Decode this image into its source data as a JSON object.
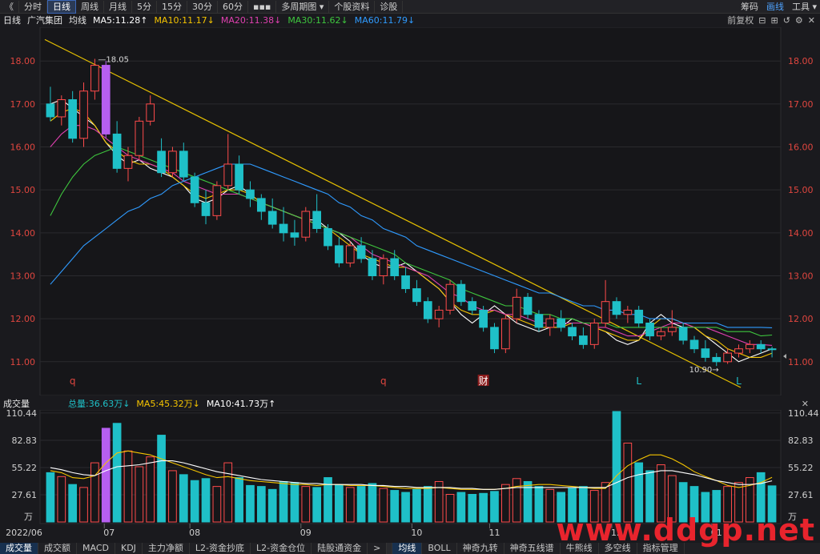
{
  "toolbar": {
    "back": "《",
    "items": [
      "分时",
      "日线",
      "周线",
      "月线",
      "5分",
      "15分",
      "30分",
      "60分",
      "▪▪▪",
      "多周期图 ▾",
      "个股资料",
      "诊股"
    ],
    "active_index": 1,
    "right": [
      "筹码",
      "画线",
      "工具 ▾"
    ]
  },
  "legend": {
    "period": "日线",
    "name": "广汽集团",
    "ma_label": "均线",
    "ma5": "MA5:11.28↑",
    "ma10": "MA10:11.17↓",
    "ma20": "MA20:11.38↓",
    "ma30": "MA30:11.62↓",
    "ma60": "MA60:11.79↓",
    "right_label": "前复权"
  },
  "volume_legend": {
    "title": "成交量",
    "total": "总量:36.63万↓",
    "ma5": "MA5:45.32万↓",
    "ma10": "MA10:41.73万↑"
  },
  "bottom_tabs": [
    "成交量",
    "成交额",
    "MACD",
    "KDJ",
    "主力净额",
    "L2-资金抄底",
    "L2-资金仓位",
    "陆股通资金",
    ">",
    "均线",
    "BOLL",
    "神奇九转",
    "神奇五线谱",
    "牛熊线",
    "多空线",
    "指标管理"
  ],
  "colors": {
    "up": "#ff4b4b",
    "down": "#1fc0c8",
    "ma5": "#ffffff",
    "ma10": "#f5c400",
    "ma20": "#e040b0",
    "ma30": "#3ec63e",
    "ma60": "#2f9bff",
    "trendline": "#e8c200",
    "highlight": "#b65ff0"
  },
  "chart_data": [
    {
      "type": "candlestick",
      "title": "广汽集团 日线",
      "y_ticks": [
        "18.00",
        "17.00",
        "16.00",
        "15.00",
        "14.00",
        "13.00",
        "12.00",
        "11.00"
      ],
      "ylim": [
        10.4,
        18.6
      ],
      "x_ticks": [
        "2022/06",
        "07",
        "08",
        "09",
        "10",
        "11",
        "12",
        "01"
      ],
      "annotations": {
        "high": "18.05",
        "low": "10.90",
        "markers": [
          "q",
          "q",
          "财",
          "L",
          "L"
        ]
      },
      "series": [
        {
          "name": "MA5",
          "values": [
            17.0,
            17.1,
            16.9,
            16.7,
            16.5,
            16.1,
            15.8,
            15.6,
            15.7,
            15.5,
            15.4,
            15.3,
            15.1,
            14.8,
            14.7,
            14.8,
            15.0,
            15.1,
            14.9,
            14.7,
            14.6,
            14.5,
            14.4,
            14.3,
            14.3,
            14.1,
            14.0,
            13.8,
            13.5,
            13.3,
            13.2,
            13.2,
            13.3,
            13.1,
            12.9,
            12.7,
            12.4,
            12.1,
            11.9,
            12.1,
            12.3,
            12.1,
            11.9,
            11.8,
            11.7,
            11.8,
            11.8,
            12.0,
            11.9,
            11.8,
            11.7,
            11.5,
            11.4,
            11.5,
            11.9,
            12.1,
            11.9,
            11.8,
            11.8,
            11.6,
            11.4,
            11.2,
            11.0,
            11.1,
            11.2,
            11.3
          ]
        },
        {
          "name": "MA10",
          "values": [
            16.6,
            16.8,
            16.9,
            16.8,
            16.5,
            16.1,
            15.9,
            15.7,
            15.6,
            15.6,
            15.5,
            15.3,
            15.1,
            14.9,
            14.8,
            14.9,
            15.0,
            15.0,
            14.9,
            14.7,
            14.6,
            14.5,
            14.4,
            14.3,
            14.2,
            14.1,
            13.9,
            13.7,
            13.5,
            13.4,
            13.3,
            13.2,
            13.2,
            13.1,
            12.9,
            12.7,
            12.4,
            12.2,
            12.1,
            12.1,
            12.2,
            12.1,
            12.0,
            11.9,
            11.8,
            11.8,
            11.8,
            11.9,
            11.9,
            11.8,
            11.7,
            11.6,
            11.5,
            11.5,
            11.8,
            12.0,
            12.0,
            11.9,
            11.8,
            11.6,
            11.5,
            11.3,
            11.2,
            11.1,
            11.1,
            11.2
          ]
        },
        {
          "name": "MA20",
          "values": [
            16.0,
            16.3,
            16.5,
            16.5,
            16.4,
            16.2,
            16.0,
            15.8,
            15.7,
            15.6,
            15.5,
            15.4,
            15.2,
            15.1,
            15.0,
            14.9,
            14.9,
            14.9,
            14.8,
            14.7,
            14.6,
            14.5,
            14.4,
            14.3,
            14.2,
            14.1,
            14.0,
            13.9,
            13.7,
            13.5,
            13.4,
            13.3,
            13.2,
            13.1,
            13.0,
            12.8,
            12.6,
            12.5,
            12.3,
            12.2,
            12.2,
            12.1,
            12.1,
            12.0,
            11.9,
            11.9,
            11.9,
            11.9,
            11.9,
            11.8,
            11.8,
            11.7,
            11.6,
            11.6,
            11.7,
            11.8,
            11.9,
            11.9,
            11.8,
            11.8,
            11.7,
            11.6,
            11.5,
            11.4,
            11.4,
            11.38
          ]
        },
        {
          "name": "MA30",
          "values": [
            14.4,
            14.9,
            15.3,
            15.6,
            15.8,
            15.9,
            16.0,
            15.9,
            15.8,
            15.7,
            15.6,
            15.5,
            15.4,
            15.3,
            15.2,
            15.1,
            15.0,
            14.9,
            14.8,
            14.7,
            14.6,
            14.5,
            14.4,
            14.3,
            14.2,
            14.1,
            14.0,
            13.9,
            13.8,
            13.7,
            13.6,
            13.5,
            13.3,
            13.2,
            13.1,
            13.0,
            12.9,
            12.7,
            12.6,
            12.5,
            12.4,
            12.3,
            12.3,
            12.2,
            12.1,
            12.1,
            12.0,
            12.0,
            11.9,
            11.9,
            11.9,
            11.8,
            11.8,
            11.8,
            11.8,
            11.8,
            11.8,
            11.8,
            11.8,
            11.8,
            11.8,
            11.7,
            11.7,
            11.7,
            11.6,
            11.62
          ]
        },
        {
          "name": "MA60",
          "values": [
            12.8,
            13.1,
            13.4,
            13.7,
            13.9,
            14.1,
            14.3,
            14.5,
            14.6,
            14.8,
            14.9,
            15.1,
            15.2,
            15.3,
            15.4,
            15.5,
            15.6,
            15.6,
            15.6,
            15.5,
            15.4,
            15.3,
            15.2,
            15.1,
            15.0,
            14.9,
            14.7,
            14.6,
            14.4,
            14.3,
            14.1,
            14.0,
            13.9,
            13.7,
            13.6,
            13.5,
            13.4,
            13.3,
            13.2,
            13.1,
            13.0,
            12.9,
            12.8,
            12.7,
            12.6,
            12.6,
            12.5,
            12.4,
            12.3,
            12.3,
            12.2,
            12.2,
            12.1,
            12.1,
            12.0,
            12.0,
            12.0,
            11.9,
            11.9,
            11.9,
            11.9,
            11.8,
            11.8,
            11.8,
            11.8,
            11.79
          ]
        }
      ],
      "candles": [
        [
          17.0,
          17.4,
          16.6,
          16.7
        ],
        [
          16.7,
          17.2,
          16.5,
          17.1
        ],
        [
          17.1,
          17.3,
          16.1,
          16.2
        ],
        [
          16.2,
          17.5,
          16.0,
          17.3
        ],
        [
          17.3,
          18.05,
          17.1,
          17.9
        ],
        [
          17.9,
          18.0,
          16.2,
          16.3
        ],
        [
          16.3,
          16.6,
          15.4,
          15.5
        ],
        [
          15.5,
          16.0,
          15.2,
          15.8
        ],
        [
          15.8,
          16.7,
          15.7,
          16.6
        ],
        [
          16.6,
          17.2,
          16.5,
          17.0
        ],
        [
          15.9,
          16.2,
          15.3,
          15.4
        ],
        [
          15.4,
          16.0,
          15.3,
          15.9
        ],
        [
          15.9,
          16.1,
          15.2,
          15.3
        ],
        [
          15.3,
          15.4,
          14.6,
          14.7
        ],
        [
          14.7,
          15.0,
          14.2,
          14.4
        ],
        [
          14.4,
          15.2,
          14.3,
          15.1
        ],
        [
          15.1,
          16.3,
          15.0,
          15.6
        ],
        [
          15.6,
          15.8,
          14.9,
          15.0
        ],
        [
          15.0,
          15.2,
          14.6,
          14.8
        ],
        [
          14.8,
          14.9,
          14.3,
          14.5
        ],
        [
          14.5,
          14.8,
          14.1,
          14.2
        ],
        [
          14.2,
          14.6,
          13.8,
          14.0
        ],
        [
          14.0,
          14.3,
          13.7,
          13.9
        ],
        [
          13.9,
          14.6,
          13.8,
          14.5
        ],
        [
          14.5,
          14.9,
          14.0,
          14.1
        ],
        [
          14.1,
          14.2,
          13.6,
          13.7
        ],
        [
          13.7,
          13.9,
          13.2,
          13.3
        ],
        [
          13.3,
          13.8,
          13.2,
          13.7
        ],
        [
          13.7,
          13.9,
          13.3,
          13.4
        ],
        [
          13.4,
          13.6,
          12.9,
          13.0
        ],
        [
          13.0,
          13.5,
          12.8,
          13.4
        ],
        [
          13.4,
          13.6,
          12.9,
          13.0
        ],
        [
          13.0,
          13.2,
          12.6,
          12.7
        ],
        [
          12.7,
          12.9,
          12.3,
          12.4
        ],
        [
          12.4,
          12.5,
          11.9,
          12.0
        ],
        [
          12.0,
          12.3,
          11.8,
          12.2
        ],
        [
          12.2,
          12.9,
          12.1,
          12.8
        ],
        [
          12.8,
          12.9,
          12.3,
          12.4
        ],
        [
          12.4,
          12.5,
          12.1,
          12.2
        ],
        [
          12.2,
          12.3,
          11.7,
          11.8
        ],
        [
          11.8,
          11.9,
          11.2,
          11.3
        ],
        [
          11.3,
          12.1,
          11.2,
          12.0
        ],
        [
          12.0,
          12.7,
          11.9,
          12.5
        ],
        [
          12.5,
          12.6,
          12.0,
          12.1
        ],
        [
          12.1,
          12.2,
          11.7,
          11.8
        ],
        [
          11.8,
          12.1,
          11.6,
          12.0
        ],
        [
          12.0,
          12.2,
          11.7,
          11.8
        ],
        [
          11.8,
          11.9,
          11.5,
          11.6
        ],
        [
          11.6,
          11.8,
          11.3,
          11.4
        ],
        [
          11.4,
          12.0,
          11.3,
          11.9
        ],
        [
          11.9,
          12.9,
          11.8,
          12.4
        ],
        [
          12.4,
          12.5,
          12.0,
          12.1
        ],
        [
          12.1,
          12.3,
          11.9,
          12.2
        ],
        [
          12.2,
          12.3,
          11.8,
          11.9
        ],
        [
          11.9,
          12.0,
          11.5,
          11.6
        ],
        [
          11.6,
          11.8,
          11.5,
          11.7
        ],
        [
          11.7,
          12.2,
          11.6,
          11.8
        ],
        [
          11.8,
          11.9,
          11.4,
          11.5
        ],
        [
          11.5,
          11.6,
          11.2,
          11.3
        ],
        [
          11.3,
          11.5,
          11.0,
          11.1
        ],
        [
          11.1,
          11.2,
          10.9,
          11.0
        ],
        [
          11.0,
          11.3,
          10.95,
          11.2
        ],
        [
          11.2,
          11.4,
          11.1,
          11.3
        ],
        [
          11.3,
          11.5,
          11.2,
          11.4
        ],
        [
          11.4,
          11.5,
          11.2,
          11.3
        ],
        [
          11.3,
          11.35,
          11.1,
          11.28
        ]
      ]
    },
    {
      "type": "bar",
      "title": "成交量",
      "y_ticks": [
        "110.44",
        "82.83",
        "55.22",
        "27.61"
      ],
      "y_unit": "万",
      "ylim": [
        0,
        112
      ],
      "values": [
        50,
        46,
        38,
        35,
        60,
        95,
        100,
        72,
        56,
        66,
        88,
        52,
        48,
        42,
        44,
        36,
        60,
        45,
        37,
        36,
        33,
        41,
        40,
        36,
        35,
        45,
        38,
        35,
        36,
        39,
        34,
        32,
        30,
        33,
        36,
        41,
        28,
        30,
        28,
        29,
        31,
        38,
        44,
        41,
        36,
        33,
        30,
        34,
        36,
        32,
        40,
        112,
        80,
        60,
        52,
        58,
        47,
        40,
        36,
        30,
        32,
        36,
        40,
        45,
        50,
        36.63
      ],
      "ma5": [
        52,
        50,
        45,
        44,
        47,
        60,
        70,
        72,
        70,
        68,
        64,
        60,
        56,
        52,
        48,
        45,
        46,
        44,
        42,
        41,
        40,
        39,
        38,
        38,
        37,
        38,
        38,
        37,
        37,
        37,
        36,
        35,
        34,
        34,
        34,
        35,
        34,
        33,
        33,
        33,
        33,
        34,
        36,
        37,
        38,
        38,
        37,
        36,
        35,
        34,
        34,
        47,
        57,
        63,
        68,
        68,
        64,
        58,
        51,
        46,
        42,
        37,
        35,
        37,
        40,
        45.32
      ],
      "ma10": [
        55,
        53,
        50,
        48,
        47,
        52,
        56,
        57,
        58,
        60,
        62,
        62,
        60,
        57,
        54,
        51,
        49,
        47,
        45,
        43,
        42,
        41,
        40,
        39,
        39,
        38,
        38,
        38,
        38,
        37,
        37,
        36,
        36,
        35,
        35,
        35,
        35,
        34,
        34,
        33,
        33,
        34,
        35,
        35,
        35,
        35,
        35,
        35,
        35,
        35,
        35,
        40,
        45,
        48,
        50,
        52,
        52,
        50,
        48,
        45,
        42,
        40,
        38,
        38,
        39,
        41.73
      ]
    }
  ]
}
